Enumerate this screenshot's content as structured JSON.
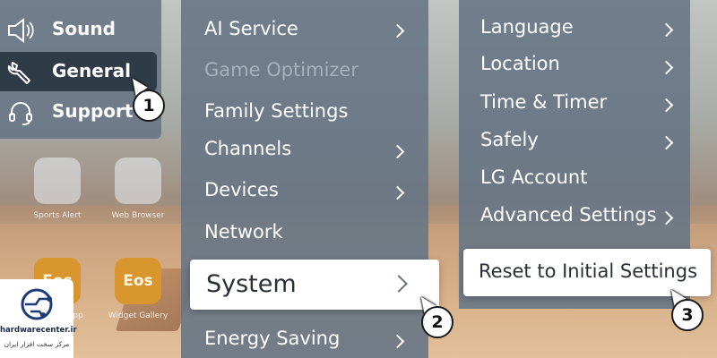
{
  "background": {
    "tiles": [
      {
        "caption": "Sports Alert"
      },
      {
        "caption": "Web Browser"
      },
      {
        "caption": "App"
      },
      {
        "caption": "Widget Gallery"
      }
    ],
    "eos_label": "Eos"
  },
  "panel1": {
    "items": [
      {
        "label": "Sound",
        "icon": "speaker-icon"
      },
      {
        "label": "General",
        "icon": "wrench-icon",
        "selected": true
      },
      {
        "label": "Support",
        "icon": "headset-icon"
      }
    ]
  },
  "panel2": {
    "items": [
      {
        "label": "AI Service",
        "chevron": true
      },
      {
        "label": "Game Optimizer",
        "disabled": true
      },
      {
        "label": "Family Settings"
      },
      {
        "label": "Channels",
        "chevron": true
      },
      {
        "label": "Devices",
        "chevron": true
      },
      {
        "label": "Network"
      },
      {
        "label": "System",
        "chevron": true,
        "selected": true
      },
      {
        "label": "Energy Saving",
        "chevron": true
      }
    ]
  },
  "panel3": {
    "items": [
      {
        "label": "Language",
        "chevron": true
      },
      {
        "label": "Location",
        "chevron": true
      },
      {
        "label": "Time & Timer",
        "chevron": true
      },
      {
        "label": "Safely",
        "chevron": true
      },
      {
        "label": "LG Account"
      },
      {
        "label": "Advanced Settings",
        "chevron": true
      },
      {
        "label": "Reset to Initial Settings",
        "selected": true
      }
    ]
  },
  "steps": [
    "1",
    "2",
    "3"
  ],
  "watermark": {
    "site": "hardwarecenter.ir",
    "tagline": "مرکز سخت افزار ایران"
  }
}
